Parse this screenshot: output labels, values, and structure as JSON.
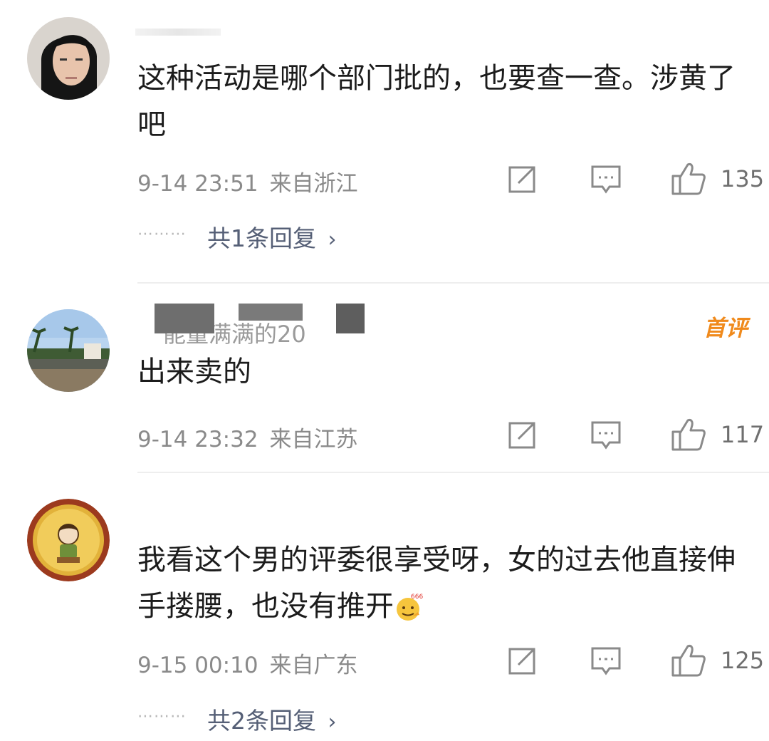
{
  "comments": [
    {
      "text": "这种活动是哪个部门批的，也要查一查。涉黄了吧",
      "date": "9-14 23:51",
      "location": "来自浙江",
      "likes": "135",
      "replies_label": "共1条回复"
    },
    {
      "username_partial": "能量满满的20",
      "badge": "首评",
      "text": "出来卖的",
      "date": "9-14 23:32",
      "location": "来自江苏",
      "likes": "117"
    },
    {
      "text": "我看这个男的评委很享受呀，女的过去他直接伸手搂腰，也没有推开",
      "emoji_label": "666",
      "date": "9-15 00:10",
      "location": "来自广东",
      "likes": "125",
      "replies_label": "共2条回复"
    }
  ],
  "colors": {
    "meta_gray": "#8a8a8a",
    "link": "#555f76",
    "badge": "#f08a1c",
    "divider": "#eeeeee"
  },
  "icons": [
    "share-icon",
    "comment-icon",
    "thumbs-up-icon",
    "chevron-right-icon"
  ]
}
